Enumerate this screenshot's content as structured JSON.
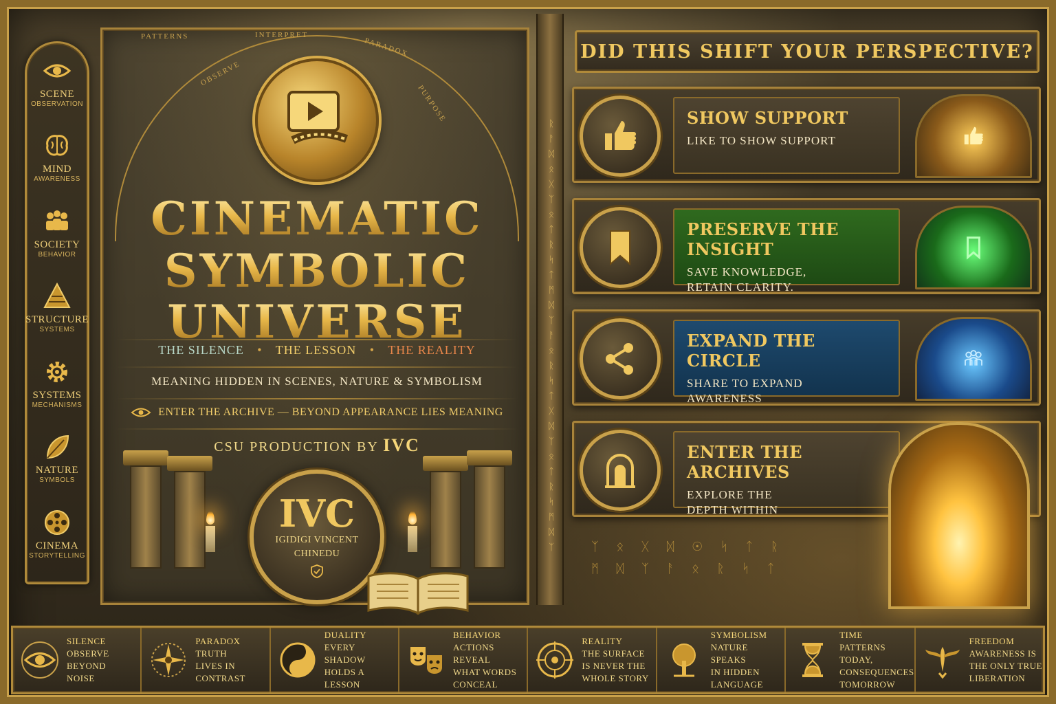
{
  "sidebar": {
    "items": [
      {
        "title": "Scene",
        "subtitle": "Observation",
        "icon": "eye-icon"
      },
      {
        "title": "Mind",
        "subtitle": "Awareness",
        "icon": "brain-icon"
      },
      {
        "title": "Society",
        "subtitle": "Behavior",
        "icon": "people-icon"
      },
      {
        "title": "Structure",
        "subtitle": "Systems",
        "icon": "pyramid-icon"
      },
      {
        "title": "Systems",
        "subtitle": "Mechanisms",
        "icon": "gear-icon"
      },
      {
        "title": "Nature",
        "subtitle": "Symbols",
        "icon": "leaf-icon"
      },
      {
        "title": "Cinema",
        "subtitle": "Storytelling",
        "icon": "film-reel-icon"
      }
    ]
  },
  "center": {
    "arc_words": [
      "PATTERNS",
      "OBSERVE",
      "INTERPRET",
      "PARADOX",
      "PURPOSE"
    ],
    "title_line1": "CINEMATIC",
    "title_line2": "SYMBOLIC",
    "title_line3": "UNIVERSE",
    "triad": [
      "THE SILENCE",
      "THE LESSON",
      "THE REALITY"
    ],
    "subline": "MEANING HIDDEN IN SCENES, NATURE & SYMBOLISM",
    "enter_line": "ENTER THE ARCHIVE — BEYOND APPEARANCE LIES MEANING",
    "production_prefix": "CSU PRODUCTION BY",
    "production_name": "IVC",
    "seal_initials": "IVC",
    "seal_name_line1": "IGIDIGI VINCENT",
    "seal_name_line2": "CHINEDU"
  },
  "right": {
    "question": "Did this shift your perspective?",
    "cards": [
      {
        "title": "Show Support",
        "description": "Like to show support",
        "icon": "thumbs-up-icon",
        "accent": "#e8b84a"
      },
      {
        "title": "Preserve the Insight",
        "description": "Save knowledge,\nretain clarity.",
        "icon": "bookmark-icon",
        "accent": "#3aa83a"
      },
      {
        "title": "Expand the Circle",
        "description": "Share to expand\nawareness",
        "icon": "share-icon",
        "accent": "#2a7ac8"
      },
      {
        "title": "Enter the Archives",
        "description": "Explore the\ndepth within",
        "icon": "archive-door-icon",
        "accent": "#ffc340"
      }
    ]
  },
  "bottom": {
    "principles": [
      {
        "heading": "Silence",
        "lines": [
          "Observe",
          "beyond",
          "noise"
        ],
        "icon": "eye-icon"
      },
      {
        "heading": "Paradox",
        "lines": [
          "Truth",
          "lives in",
          "contrast"
        ],
        "icon": "compass-star-icon"
      },
      {
        "heading": "Duality",
        "lines": [
          "Every shadow",
          "holds a",
          "lesson"
        ],
        "icon": "yin-yang-icon"
      },
      {
        "heading": "Behavior",
        "lines": [
          "Actions reveal",
          "what words",
          "conceal"
        ],
        "icon": "masks-icon"
      },
      {
        "heading": "Reality",
        "lines": [
          "The surface",
          "is never the",
          "whole story"
        ],
        "icon": "target-icon"
      },
      {
        "heading": "Symbolism",
        "lines": [
          "Nature speaks",
          "in hidden",
          "language"
        ],
        "icon": "tree-icon"
      },
      {
        "heading": "Time",
        "lines": [
          "Patterns today,",
          "consequences",
          "tomorrow"
        ],
        "icon": "hourglass-icon"
      },
      {
        "heading": "Freedom",
        "lines": [
          "Awareness is",
          "the only true",
          "liberation"
        ],
        "icon": "phoenix-icon"
      }
    ]
  },
  "colors": {
    "gold": "#e8c46a",
    "stone": "#3b3424",
    "green_panel": "#2f6a1e",
    "blue_panel": "#1e4a6e",
    "reality_accent": "#e8864a"
  }
}
